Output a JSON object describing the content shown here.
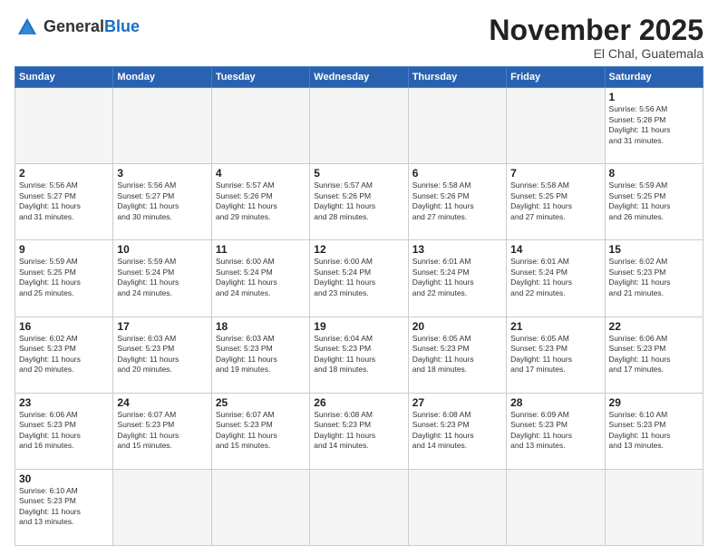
{
  "header": {
    "logo_general": "General",
    "logo_blue": "Blue",
    "month_title": "November 2025",
    "subtitle": "El Chal, Guatemala"
  },
  "weekdays": [
    "Sunday",
    "Monday",
    "Tuesday",
    "Wednesday",
    "Thursday",
    "Friday",
    "Saturday"
  ],
  "days": [
    {
      "date": 1,
      "sunrise": "5:56 AM",
      "sunset": "5:28 PM",
      "daylight_hours": 11,
      "daylight_minutes": 31
    },
    {
      "date": 2,
      "sunrise": "5:56 AM",
      "sunset": "5:27 PM",
      "daylight_hours": 11,
      "daylight_minutes": 31
    },
    {
      "date": 3,
      "sunrise": "5:56 AM",
      "sunset": "5:27 PM",
      "daylight_hours": 11,
      "daylight_minutes": 30
    },
    {
      "date": 4,
      "sunrise": "5:57 AM",
      "sunset": "5:26 PM",
      "daylight_hours": 11,
      "daylight_minutes": 29
    },
    {
      "date": 5,
      "sunrise": "5:57 AM",
      "sunset": "5:26 PM",
      "daylight_hours": 11,
      "daylight_minutes": 28
    },
    {
      "date": 6,
      "sunrise": "5:58 AM",
      "sunset": "5:26 PM",
      "daylight_hours": 11,
      "daylight_minutes": 27
    },
    {
      "date": 7,
      "sunrise": "5:58 AM",
      "sunset": "5:25 PM",
      "daylight_hours": 11,
      "daylight_minutes": 27
    },
    {
      "date": 8,
      "sunrise": "5:59 AM",
      "sunset": "5:25 PM",
      "daylight_hours": 11,
      "daylight_minutes": 26
    },
    {
      "date": 9,
      "sunrise": "5:59 AM",
      "sunset": "5:25 PM",
      "daylight_hours": 11,
      "daylight_minutes": 25
    },
    {
      "date": 10,
      "sunrise": "5:59 AM",
      "sunset": "5:24 PM",
      "daylight_hours": 11,
      "daylight_minutes": 24
    },
    {
      "date": 11,
      "sunrise": "6:00 AM",
      "sunset": "5:24 PM",
      "daylight_hours": 11,
      "daylight_minutes": 24
    },
    {
      "date": 12,
      "sunrise": "6:00 AM",
      "sunset": "5:24 PM",
      "daylight_hours": 11,
      "daylight_minutes": 23
    },
    {
      "date": 13,
      "sunrise": "6:01 AM",
      "sunset": "5:24 PM",
      "daylight_hours": 11,
      "daylight_minutes": 22
    },
    {
      "date": 14,
      "sunrise": "6:01 AM",
      "sunset": "5:24 PM",
      "daylight_hours": 11,
      "daylight_minutes": 22
    },
    {
      "date": 15,
      "sunrise": "6:02 AM",
      "sunset": "5:23 PM",
      "daylight_hours": 11,
      "daylight_minutes": 21
    },
    {
      "date": 16,
      "sunrise": "6:02 AM",
      "sunset": "5:23 PM",
      "daylight_hours": 11,
      "daylight_minutes": 20
    },
    {
      "date": 17,
      "sunrise": "6:03 AM",
      "sunset": "5:23 PM",
      "daylight_hours": 11,
      "daylight_minutes": 20
    },
    {
      "date": 18,
      "sunrise": "6:03 AM",
      "sunset": "5:23 PM",
      "daylight_hours": 11,
      "daylight_minutes": 19
    },
    {
      "date": 19,
      "sunrise": "6:04 AM",
      "sunset": "5:23 PM",
      "daylight_hours": 11,
      "daylight_minutes": 18
    },
    {
      "date": 20,
      "sunrise": "6:05 AM",
      "sunset": "5:23 PM",
      "daylight_hours": 11,
      "daylight_minutes": 18
    },
    {
      "date": 21,
      "sunrise": "6:05 AM",
      "sunset": "5:23 PM",
      "daylight_hours": 11,
      "daylight_minutes": 17
    },
    {
      "date": 22,
      "sunrise": "6:06 AM",
      "sunset": "5:23 PM",
      "daylight_hours": 11,
      "daylight_minutes": 17
    },
    {
      "date": 23,
      "sunrise": "6:06 AM",
      "sunset": "5:23 PM",
      "daylight_hours": 11,
      "daylight_minutes": 16
    },
    {
      "date": 24,
      "sunrise": "6:07 AM",
      "sunset": "5:23 PM",
      "daylight_hours": 11,
      "daylight_minutes": 15
    },
    {
      "date": 25,
      "sunrise": "6:07 AM",
      "sunset": "5:23 PM",
      "daylight_hours": 11,
      "daylight_minutes": 15
    },
    {
      "date": 26,
      "sunrise": "6:08 AM",
      "sunset": "5:23 PM",
      "daylight_hours": 11,
      "daylight_minutes": 14
    },
    {
      "date": 27,
      "sunrise": "6:08 AM",
      "sunset": "5:23 PM",
      "daylight_hours": 11,
      "daylight_minutes": 14
    },
    {
      "date": 28,
      "sunrise": "6:09 AM",
      "sunset": "5:23 PM",
      "daylight_hours": 11,
      "daylight_minutes": 13
    },
    {
      "date": 29,
      "sunrise": "6:10 AM",
      "sunset": "5:23 PM",
      "daylight_hours": 11,
      "daylight_minutes": 13
    },
    {
      "date": 30,
      "sunrise": "6:10 AM",
      "sunset": "5:23 PM",
      "daylight_hours": 11,
      "daylight_minutes": 13
    }
  ]
}
